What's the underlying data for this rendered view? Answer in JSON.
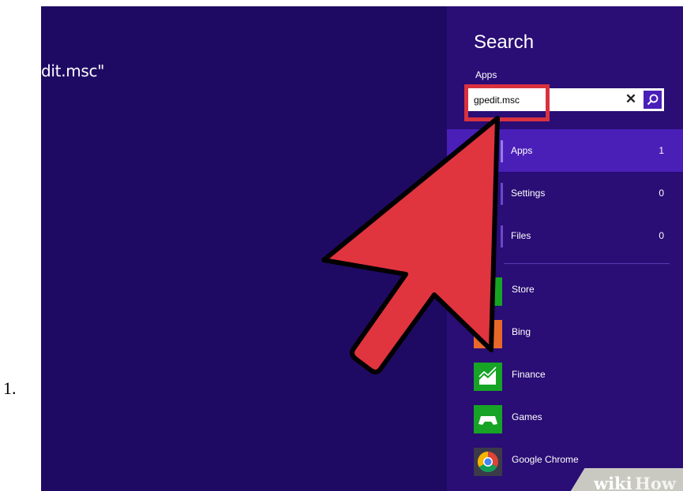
{
  "list_number": "1.",
  "background_text": "dit.msc\"",
  "search_pane": {
    "title": "Search",
    "scope": "Apps",
    "query": "gpedit.msc",
    "clear_glyph": "✕",
    "search_icon": "magnifier-icon"
  },
  "categories": [
    {
      "label": "Apps",
      "count": "1"
    },
    {
      "label": "Settings",
      "count": "0"
    },
    {
      "label": "Files",
      "count": "0"
    }
  ],
  "apps": [
    {
      "label": "Store",
      "icon": "store-icon"
    },
    {
      "label": "Bing",
      "icon": "bing-icon"
    },
    {
      "label": "Finance",
      "icon": "finance-icon"
    },
    {
      "label": "Games",
      "icon": "games-icon"
    },
    {
      "label": "Google Chrome",
      "icon": "chrome-icon"
    }
  ],
  "watermark": {
    "wiki": "wiki",
    "how": "How"
  },
  "colors": {
    "background": "#1f0a63",
    "pane": "#2a0d75",
    "accent": "#4a1fb8",
    "arrow": "#e0343f",
    "highlight": "#d9323e"
  }
}
